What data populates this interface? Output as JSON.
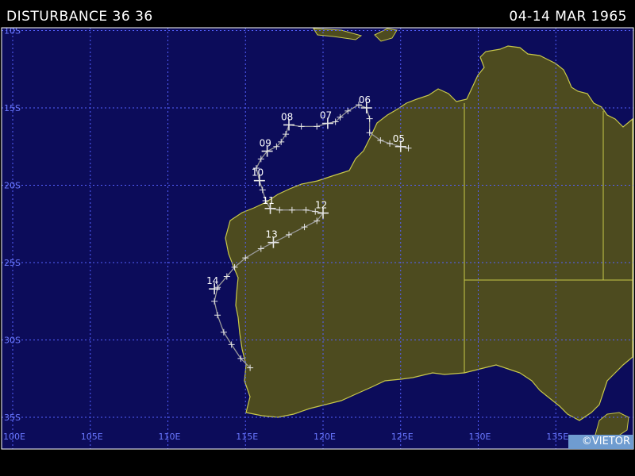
{
  "header": {
    "title": "DISTURBANCE 36 36",
    "date_range": "04-14 MAR 1965"
  },
  "map": {
    "lat_labels": [
      "10S",
      "15S",
      "20S",
      "25S",
      "30S",
      "35S"
    ],
    "lon_labels": [
      "100E",
      "105E",
      "110E",
      "115E",
      "120E",
      "125E",
      "130E",
      "135E"
    ],
    "colors": {
      "ocean": "#0c0c5a",
      "land": "#4d4b1f",
      "coast": "#c8c84a",
      "grid": "#5560ff",
      "track": "#9a9a9a",
      "marker": "#e6e6e6"
    }
  },
  "track": {
    "day_labels": [
      "05",
      "06",
      "07",
      "08",
      "09",
      "10",
      "11",
      "12",
      "13",
      "14"
    ],
    "points": [
      [
        125.5,
        -17.6
      ],
      [
        125.0,
        -17.5
      ],
      [
        124.3,
        -17.3
      ],
      [
        123.7,
        -17.1
      ],
      [
        123.0,
        -16.6
      ],
      [
        123.0,
        -15.7
      ],
      [
        122.8,
        -15.0
      ],
      [
        122.3,
        -14.8
      ],
      [
        121.6,
        -15.2
      ],
      [
        121.1,
        -15.6
      ],
      [
        120.8,
        -15.9
      ],
      [
        120.3,
        -16.0
      ],
      [
        119.6,
        -16.2
      ],
      [
        118.6,
        -16.2
      ],
      [
        117.8,
        -16.1
      ],
      [
        117.6,
        -16.7
      ],
      [
        117.3,
        -17.2
      ],
      [
        117.0,
        -17.5
      ],
      [
        116.4,
        -17.8
      ],
      [
        116.0,
        -18.3
      ],
      [
        115.7,
        -18.9
      ],
      [
        115.9,
        -19.7
      ],
      [
        116.1,
        -20.3
      ],
      [
        116.3,
        -21.0
      ],
      [
        116.6,
        -21.5
      ],
      [
        117.2,
        -21.6
      ],
      [
        118.0,
        -21.6
      ],
      [
        118.9,
        -21.6
      ],
      [
        119.5,
        -21.7
      ],
      [
        120.0,
        -21.8
      ],
      [
        119.6,
        -22.3
      ],
      [
        118.8,
        -22.7
      ],
      [
        117.8,
        -23.2
      ],
      [
        116.8,
        -23.7
      ],
      [
        116.0,
        -24.1
      ],
      [
        115.0,
        -24.7
      ],
      [
        114.3,
        -25.3
      ],
      [
        113.8,
        -25.9
      ],
      [
        113.2,
        -26.6
      ],
      [
        113.0,
        -27.5
      ],
      [
        113.2,
        -28.4
      ],
      [
        113.6,
        -29.5
      ],
      [
        114.1,
        -30.3
      ],
      [
        114.7,
        -31.2
      ],
      [
        115.3,
        -31.8
      ]
    ],
    "labeled": [
      {
        "day": 0,
        "lon": 125.0,
        "lat": -17.5
      },
      {
        "day": 1,
        "lon": 122.8,
        "lat": -15.0
      },
      {
        "day": 2,
        "lon": 120.3,
        "lat": -16.0
      },
      {
        "day": 3,
        "lon": 117.8,
        "lat": -16.1
      },
      {
        "day": 4,
        "lon": 116.4,
        "lat": -17.8
      },
      {
        "day": 5,
        "lon": 115.9,
        "lat": -19.7
      },
      {
        "day": 6,
        "lon": 116.6,
        "lat": -21.5
      },
      {
        "day": 7,
        "lon": 120.0,
        "lat": -21.8
      },
      {
        "day": 8,
        "lon": 116.8,
        "lat": -23.7
      },
      {
        "day": 9,
        "lon": 113.0,
        "lat": -26.7
      }
    ]
  },
  "credit": "©VIETOR"
}
